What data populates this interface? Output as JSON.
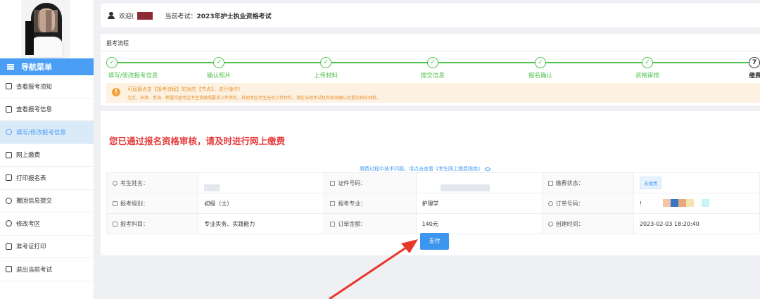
{
  "sidebar": {
    "nav_title": "导航菜单",
    "items": [
      {
        "label": "查看报考须知",
        "active": false
      },
      {
        "label": "查看报考信息",
        "active": false
      },
      {
        "label": "填写/修改报考信息",
        "active": true
      },
      {
        "label": "网上缴费",
        "active": false
      },
      {
        "label": "打印报名表",
        "active": false
      },
      {
        "label": "撤回信息提交",
        "active": false
      },
      {
        "label": "修改考区",
        "active": false
      },
      {
        "label": "准考证打印",
        "active": false
      },
      {
        "label": "退出当前考试",
        "active": false
      }
    ]
  },
  "topbar": {
    "welcome": "欢迎(",
    "current_exam_label": "当前考试：",
    "current_exam": "2023年护士执业资格考试"
  },
  "process": {
    "title": "报考流程",
    "steps": [
      "填写/修改报考信息",
      "确认照片",
      "上传材料",
      "提交信息",
      "报名确认",
      "资格审核",
      "缴费"
    ],
    "last_step_number": "7",
    "notice_line1": "可直接点击【报考流程】的对应【节点】，进行操作！",
    "notice_line2": "北京、天津、青海、新疆兵团考区考生请按照要求上传资料，其他考区考生无须上传材料，请在当地考试机构现场确认时提交相应材料。"
  },
  "main": {
    "pass_message": "您已通过报名资格审核，请及时进行网上缴费",
    "help_text": "缴费过程中技术问题，请点击查看《考生网上缴费指南》",
    "table": {
      "name_label": "考生姓名：",
      "id_label": "证件号码：",
      "pay_status_label": "缴费状态：",
      "pay_status": "未缴费",
      "level_label": "报考级别：",
      "level": "初级（士）",
      "major_label": "报考专业：",
      "major": "护理学",
      "order_no_label": "订单号码：",
      "order_no_prefix": "!",
      "subject_label": "报考科目：",
      "subject": "专业实务、实践能力",
      "amount_label": "订单金额：",
      "amount": "140元",
      "created_label": "创建时间：",
      "created": "2023-02-03 18:20:40"
    },
    "pay_button": "支付"
  },
  "colors": {
    "accent": "#4a9ff5",
    "success": "#4ec24e",
    "alert_red": "#e53a3a",
    "arrow_red": "#e8362a"
  }
}
